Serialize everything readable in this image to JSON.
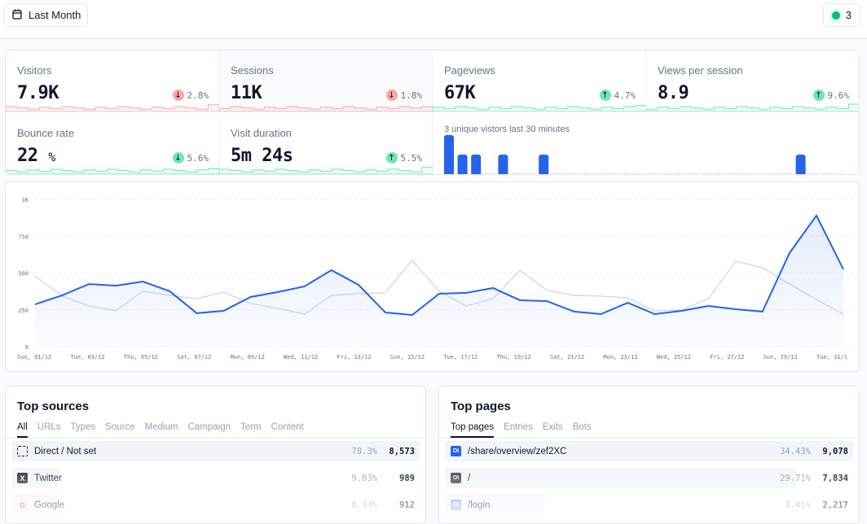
{
  "header": {
    "date_range_label": "Last Month",
    "calendar_icon": "calendar-icon",
    "realtime_count": "3"
  },
  "colors": {
    "accent": "#2563eb",
    "up": "#6ee7b7",
    "down": "#fca5a5",
    "live": "#10b981"
  },
  "kpis": [
    {
      "label": "Visitors",
      "value": "7.9K",
      "unit": "",
      "change": "2.8%",
      "direction": "down",
      "tone": "down"
    },
    {
      "label": "Sessions",
      "value": "11K",
      "unit": "",
      "change": "1.8%",
      "direction": "down",
      "tone": "down"
    },
    {
      "label": "Pageviews",
      "value": "67K",
      "unit": "",
      "change": "4.7%",
      "direction": "up",
      "tone": "up"
    },
    {
      "label": "Views per session",
      "value": "8.9",
      "unit": "",
      "change": "9.6%",
      "direction": "up",
      "tone": "up"
    },
    {
      "label": "Bounce rate",
      "value": "22",
      "unit": "%",
      "change": "5.6%",
      "direction": "down",
      "tone": "up"
    },
    {
      "label": "Visit duration",
      "value": "5m 24s",
      "unit": "",
      "change": "5.5%",
      "direction": "up",
      "tone": "up"
    }
  ],
  "realtime": {
    "label": "3 unique vistors last 30 minutes",
    "per_minute": [
      2,
      1,
      1,
      0,
      1,
      0,
      0,
      1,
      0,
      0,
      0,
      0,
      0,
      0,
      0,
      0,
      0,
      0,
      0,
      0,
      0,
      0,
      0,
      0,
      0,
      0,
      1,
      0,
      0,
      0
    ]
  },
  "chart_data": {
    "type": "line",
    "x": [
      "Sun, 01/12",
      "Mon, 02/12",
      "Tue, 03/12",
      "Wed, 04/12",
      "Thu, 05/12",
      "Fri, 06/12",
      "Sat, 07/12",
      "Sun, 08/12",
      "Mon, 09/12",
      "Tue, 10/12",
      "Wed, 11/12",
      "Thu, 12/12",
      "Fri, 13/12",
      "Sat, 14/12",
      "Sun, 15/12",
      "Mon, 16/12",
      "Tue, 17/12",
      "Wed, 18/12",
      "Thu, 19/12",
      "Fri, 20/12",
      "Sat, 21/12",
      "Sun, 22/12",
      "Mon, 23/12",
      "Tue, 24/12",
      "Wed, 25/12",
      "Thu, 26/12",
      "Fri, 27/12",
      "Sat, 28/12",
      "Sun, 29/12",
      "Mon, 30/12",
      "Tue, 31/12"
    ],
    "tick_labels": [
      "Sun, 01/12",
      "Tue, 03/12",
      "Thu, 05/12",
      "Sat, 07/12",
      "Mon, 09/12",
      "Wed, 11/12",
      "Fri, 13/12",
      "Sun, 15/12",
      "Tue, 17/12",
      "Thu, 19/12",
      "Sat, 21/12",
      "Mon, 23/12",
      "Wed, 25/12",
      "Fri, 27/12",
      "Sun, 29/12",
      "Tue, 31/1"
    ],
    "y_ticks": [
      "0",
      "250",
      "500",
      "750",
      "1K"
    ],
    "ylim": [
      0,
      1000
    ],
    "grid": true,
    "series": [
      {
        "values": [
          287,
          348,
          425,
          414,
          442,
          376,
          227,
          243,
          337,
          370,
          409,
          519,
          420,
          232,
          215,
          359,
          365,
          398,
          315,
          309,
          238,
          221,
          298,
          221,
          243,
          276,
          254,
          238,
          635,
          890,
          525
        ],
        "color": "#2563eb",
        "style": "solid-area"
      },
      {
        "values": [
          481,
          343,
          276,
          243,
          376,
          348,
          326,
          370,
          293,
          260,
          221,
          348,
          359,
          365,
          586,
          376,
          276,
          326,
          519,
          381,
          348,
          343,
          331,
          243,
          249,
          326,
          580,
          536,
          425,
          320,
          221
        ],
        "color": "#c7d2fe",
        "style": "thin"
      }
    ]
  },
  "top_sources": {
    "title": "Top sources",
    "tabs": [
      "All",
      "URLs",
      "Types",
      "Source",
      "Medium",
      "Campaign",
      "Term",
      "Content"
    ],
    "rows": [
      {
        "icon": "direct-icon",
        "name": "Direct / Not set",
        "pct": "78.3%",
        "count": "8,573",
        "share": 1
      },
      {
        "icon": "x-twitter-icon",
        "name": "Twitter",
        "pct": "9.03%",
        "count": "989",
        "share": 0.115
      },
      {
        "icon": "google-icon",
        "name": "Google",
        "pct": "8.33%",
        "count": "912",
        "share": 0.106
      }
    ]
  },
  "top_pages": {
    "title": "Top pages",
    "tabs": [
      "Top pages",
      "Entries",
      "Exits",
      "Bots"
    ],
    "rows": [
      {
        "icon": "page-icon",
        "name": "/share/overview/zef2XC",
        "pct": "34.43%",
        "count": "9,078",
        "share": 1
      },
      {
        "icon": "page-icon",
        "name": "/",
        "pct": "29.71%",
        "count": "7,834",
        "share": 0.863
      },
      {
        "icon": "page-icon",
        "name": "/login",
        "pct": "8.41%",
        "count": "2,217",
        "share": 0.244
      }
    ]
  }
}
